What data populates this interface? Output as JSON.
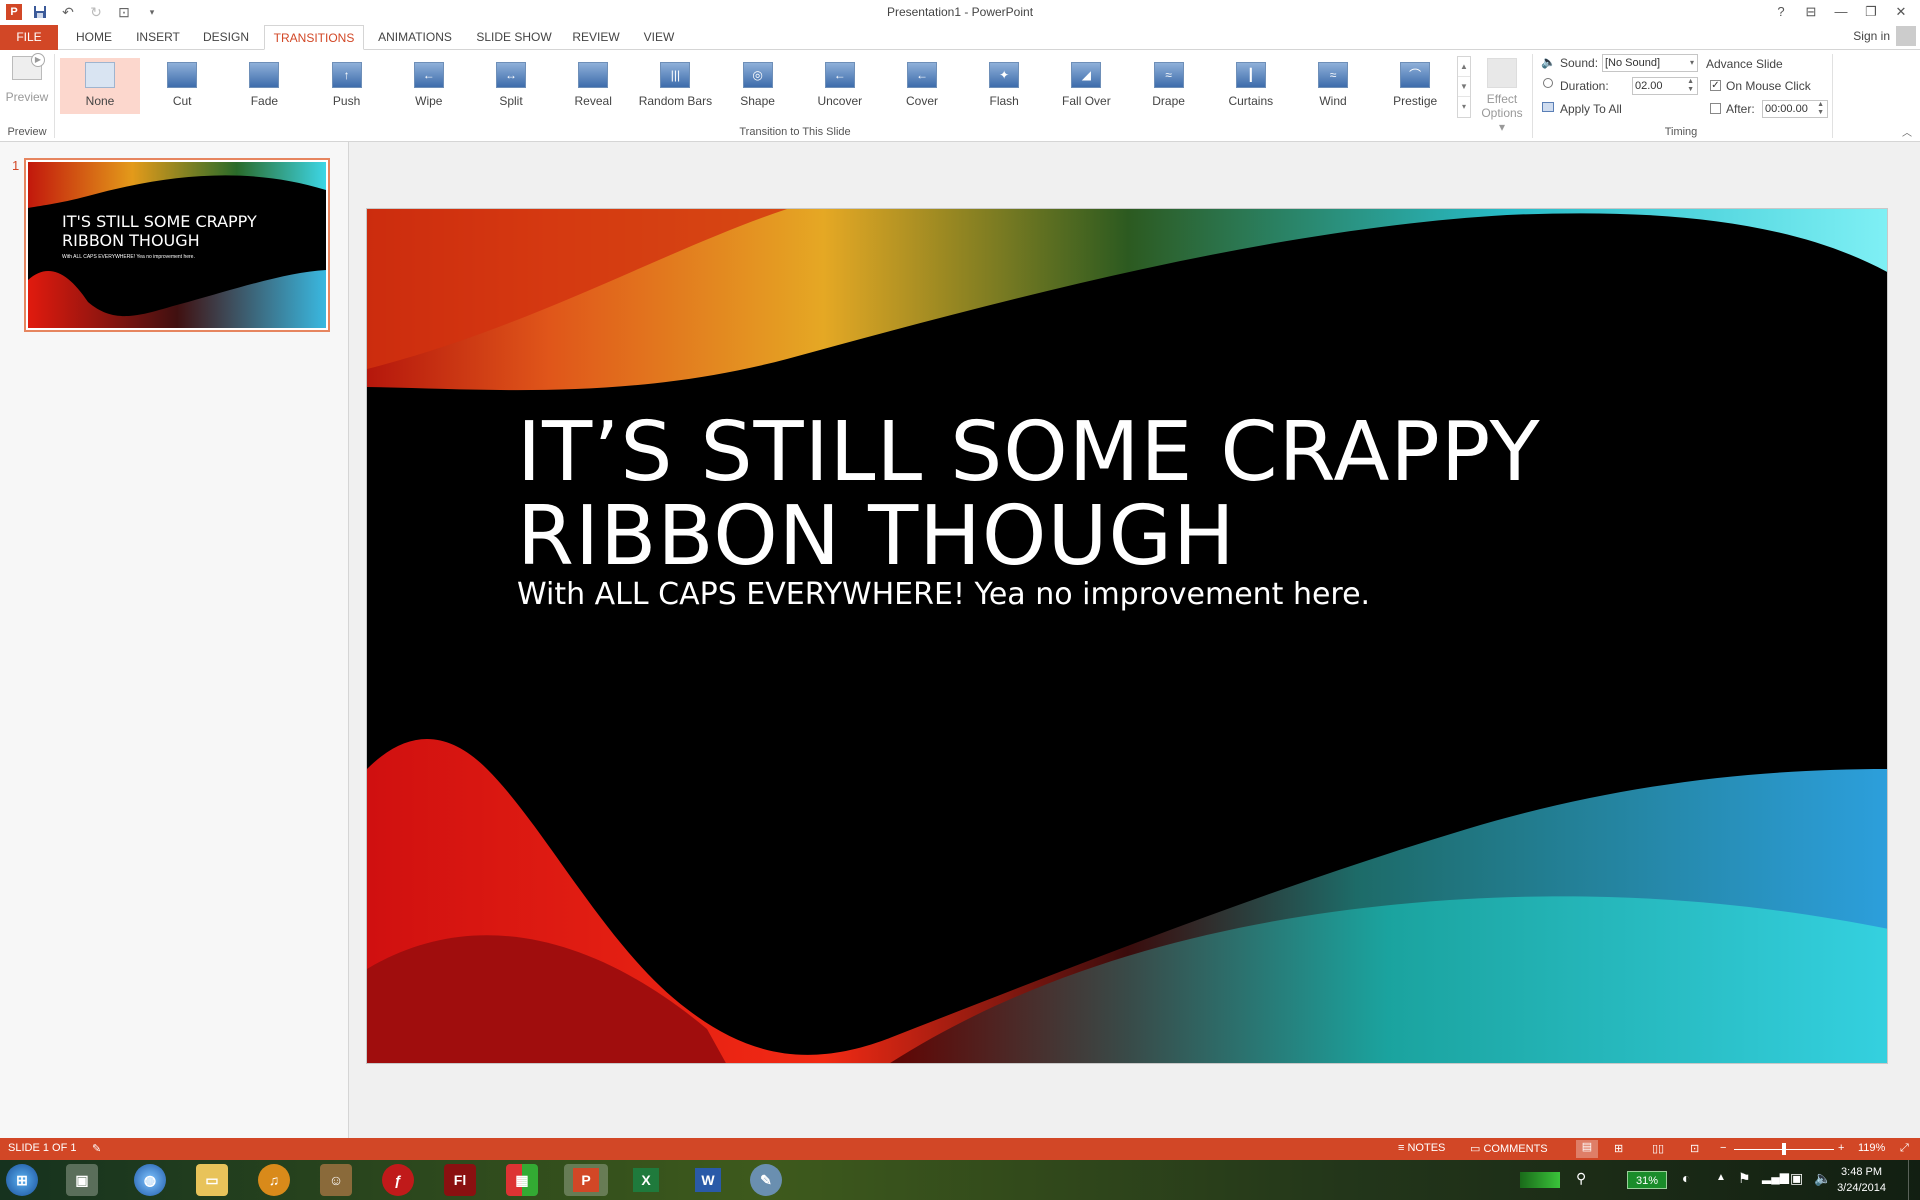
{
  "app": {
    "title": "Presentation1 - PowerPoint",
    "signin": "Sign in"
  },
  "tabs": [
    "FILE",
    "HOME",
    "INSERT",
    "DESIGN",
    "TRANSITIONS",
    "ANIMATIONS",
    "SLIDE SHOW",
    "REVIEW",
    "VIEW"
  ],
  "active_tab": "TRANSITIONS",
  "ribbon": {
    "preview_label": "Preview",
    "preview_group": "Preview",
    "transitions": [
      "None",
      "Cut",
      "Fade",
      "Push",
      "Wipe",
      "Split",
      "Reveal",
      "Random Bars",
      "Shape",
      "Uncover",
      "Cover",
      "Flash",
      "Fall Over",
      "Drape",
      "Curtains",
      "Wind",
      "Prestige"
    ],
    "selected_transition": "None",
    "transition_group": "Transition to This Slide",
    "effect_options_line1": "Effect",
    "effect_options_line2": "Options",
    "timing": {
      "sound_label": "Sound:",
      "sound_value": "[No Sound]",
      "duration_label": "Duration:",
      "duration_value": "02.00",
      "apply_all": "Apply To All",
      "advance_label": "Advance Slide",
      "on_mouse_click": "On Mouse Click",
      "on_mouse_click_checked": true,
      "after_label": "After:",
      "after_value": "00:00.00",
      "after_checked": false,
      "group": "Timing"
    }
  },
  "slides_pane": {
    "slide_number": "1",
    "thumb_title_1": "IT'S STILL SOME CRAPPY",
    "thumb_title_2": "RIBBON THOUGH",
    "thumb_subtitle": "With ALL CAPS EVERYWHERE! Yea no improvement here."
  },
  "slide": {
    "title_line1": "IT’S STILL SOME CRAPPY",
    "title_line2": "RIBBON THOUGH",
    "subtitle": "With ALL CAPS EVERYWHERE! Yea no improvement here."
  },
  "status": {
    "slide_info": "SLIDE 1 OF 1",
    "notes": "NOTES",
    "comments": "COMMENTS",
    "zoom": "119%"
  },
  "taskbar": {
    "battery": "31%",
    "time": "3:48 PM",
    "date": "3/24/2014",
    "apps": [
      "Start",
      "Computer",
      "Internet",
      "Folder",
      "Media",
      "GIMP",
      "Flash Player",
      "Fl",
      "Multicolor",
      "P",
      "X",
      "W",
      "Paint"
    ]
  },
  "colors": {
    "accent": "#d24726",
    "selected_bg": "#fcd7cd",
    "slide_bg": "#000000"
  }
}
